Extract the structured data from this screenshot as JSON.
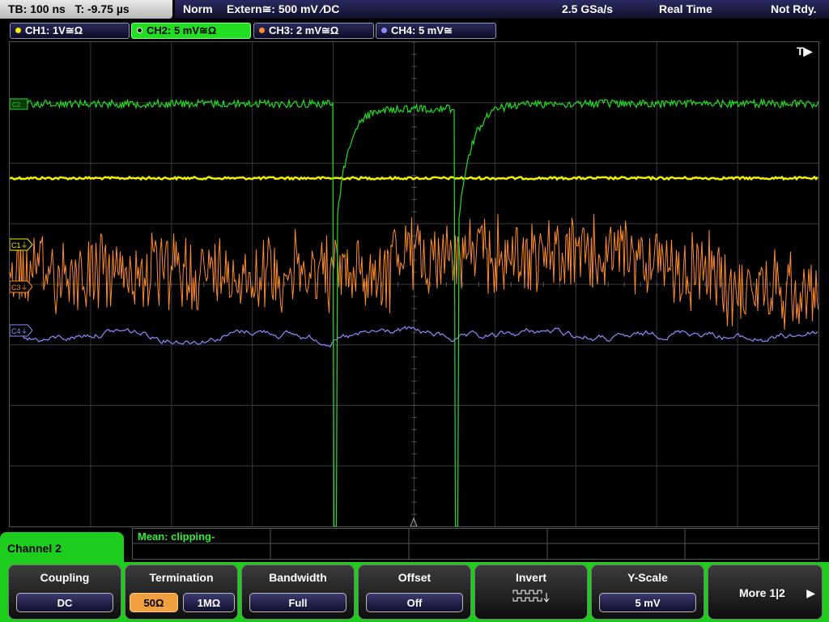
{
  "top_bar": {
    "timebase": "TB: 100 ns   T: -9.75 µs",
    "trigger_mode": "Norm",
    "trigger_source": "Extern≅: 500 mV ⁄DC",
    "sample_rate": "2.5 GSa/s",
    "acq_mode": "Real Time",
    "state": "Not Rdy."
  },
  "channel_tabs": [
    {
      "label": "CH1: 1V≅Ω",
      "color": "#f0f000",
      "active": false
    },
    {
      "label": "CH2: 5 mV≅Ω",
      "color": "#22dd22",
      "active": true
    },
    {
      "label": "CH3: 2 mV≅Ω",
      "color": "#ff8c28",
      "active": false
    },
    {
      "label": "CH4: 5 mV≅",
      "color": "#8c8cff",
      "active": false
    }
  ],
  "markers": {
    "trigger": "T▶",
    "c1": "C1⏚",
    "c3": "C3⏚",
    "c4": "C4⏚",
    "c2": "C2"
  },
  "measurement": {
    "text": "Mean: clipping-"
  },
  "menu": {
    "channel_label": "Channel 2",
    "coupling": {
      "title": "Coupling",
      "value": "DC"
    },
    "termination": {
      "title": "Termination",
      "opt1": "50Ω",
      "opt2": "1MΩ",
      "selected": "50Ω"
    },
    "bandwidth": {
      "title": "Bandwidth",
      "value": "Full"
    },
    "offset": {
      "title": "Offset",
      "value": "Off"
    },
    "invert": {
      "title": "Invert",
      "icon": "invert-waveform-icon"
    },
    "yscale": {
      "title": "Y-Scale",
      "value": "5 mV"
    },
    "more": {
      "label": "More 1|2",
      "icon": "triangle-right-icon"
    }
  },
  "colors": {
    "ch1": "#f0f000",
    "ch2": "#22dd22",
    "ch3": "#ff8c28",
    "ch4": "#8c8cff",
    "menu_accent": "#1ecc1e"
  }
}
